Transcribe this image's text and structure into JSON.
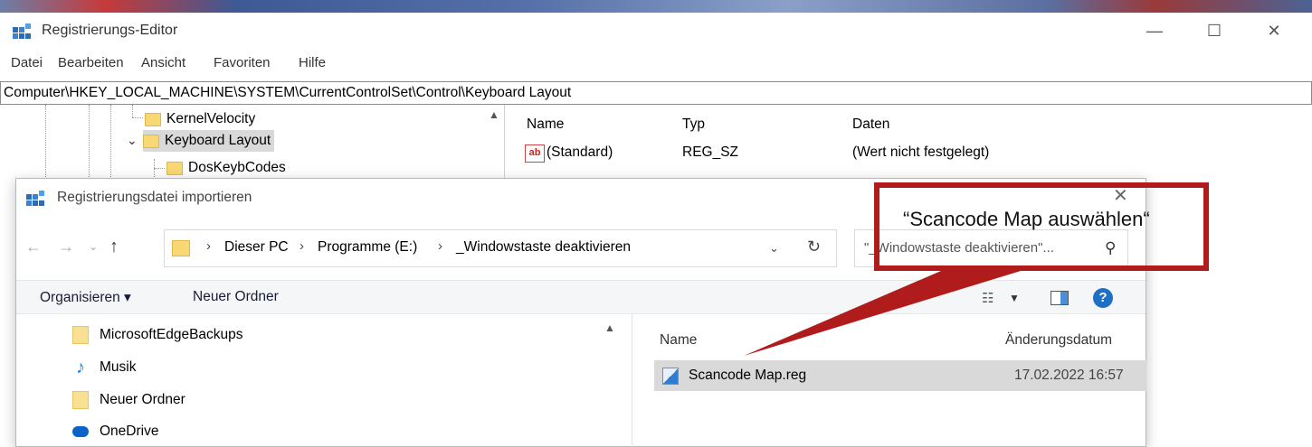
{
  "app": {
    "title": "Registrierungs-Editor",
    "minimize": "—",
    "maximize": "☐",
    "close": "✕"
  },
  "menu": {
    "items": [
      "Datei",
      "Bearbeiten",
      "Ansicht",
      "Favoriten",
      "Hilfe"
    ]
  },
  "address": {
    "value": "Computer\\HKEY_LOCAL_MACHINE\\SYSTEM\\CurrentControlSet\\Control\\Keyboard Layout"
  },
  "tree": {
    "items": [
      {
        "label": "KernelVelocity",
        "expanded": false
      },
      {
        "label": "Keyboard Layout",
        "expanded": true,
        "selected": true
      },
      {
        "label": "DosKeybCodes",
        "expanded": false
      }
    ]
  },
  "values": {
    "columns": [
      "Name",
      "Typ",
      "Daten"
    ],
    "rows": [
      {
        "icon": "string-value-icon",
        "icon_text": "ab",
        "name": "(Standard)",
        "type": "REG_SZ",
        "data": "(Wert nicht festgelegt)"
      }
    ]
  },
  "dialog": {
    "title": "Registrierungsdatei importieren",
    "close": "✕",
    "breadcrumb": [
      "Dieser PC",
      "Programme (E:)",
      "_Windowstaste deaktivieren"
    ],
    "search_placeholder": "\"_Windowstaste deaktivieren\"...",
    "toolbar": {
      "organize": "Organisieren ▾",
      "new_folder": "Neuer Ordner"
    },
    "nav_items": [
      {
        "label": "MicrosoftEdgeBackups",
        "icon": "folder-icon"
      },
      {
        "label": "Musik",
        "icon": "music-icon"
      },
      {
        "label": "Neuer Ordner",
        "icon": "folder-icon"
      },
      {
        "label": "OneDrive",
        "icon": "cloud-icon"
      }
    ],
    "file_columns": [
      "Name",
      "Änderungsdatum"
    ],
    "files": [
      {
        "name": "Scancode Map.reg",
        "modified": "17.02.2022 16:57",
        "selected": true
      }
    ]
  },
  "annotation": {
    "text": "“Scancode Map auswählen“",
    "color": "#b01c1c"
  }
}
